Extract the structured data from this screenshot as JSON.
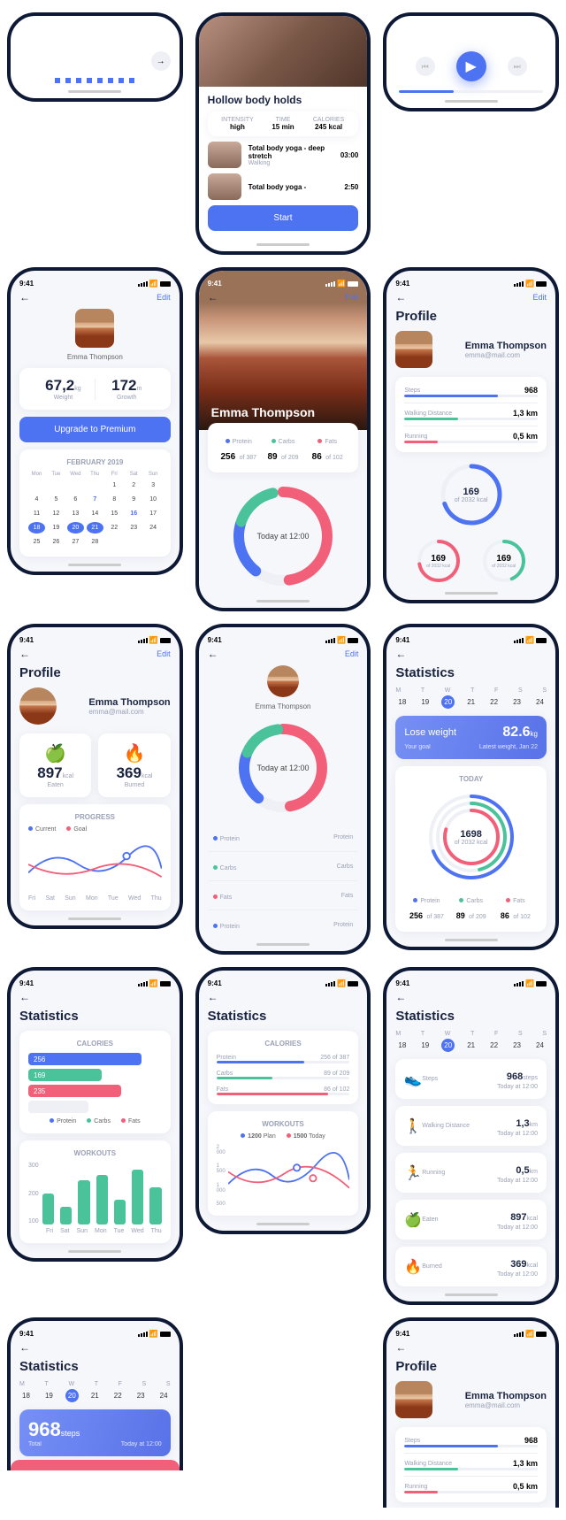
{
  "time": "9:41",
  "edit": "Edit",
  "user": {
    "name": "Emma Thompson",
    "email": "emma@mail.com"
  },
  "profileTitle": "Profile",
  "statsTitle": "Statistics",
  "upgrade": "Upgrade to Premium",
  "month": "FEBRUARY 2019",
  "weekdays": [
    "Mon",
    "Tue",
    "Wed",
    "Thu",
    "Fri",
    "Sat",
    "Sun"
  ],
  "weekLetters": [
    "M",
    "T",
    "W",
    "T",
    "F",
    "S",
    "S"
  ],
  "weekDates": [
    "18",
    "19",
    "20",
    "21",
    "22",
    "23",
    "24"
  ],
  "stats": {
    "weight": {
      "val": "67,2",
      "unit": "kg",
      "label": "Weight"
    },
    "growth": {
      "val": "172",
      "unit": "m",
      "label": "Growth"
    },
    "eaten": {
      "val": "897",
      "unit": "kcal",
      "label": "Eaten"
    },
    "burned": {
      "val": "369",
      "unit": "kcal",
      "label": "Burned"
    }
  },
  "progress": {
    "title": "PROGRESS",
    "current": "Current",
    "goal": "Goal"
  },
  "workout": {
    "title": "Hollow body holds",
    "intensity": {
      "label": "INTENSITY",
      "val": "high"
    },
    "time": {
      "label": "TIME",
      "val": "15 min"
    },
    "calories": {
      "label": "CALORIES",
      "val": "245 kcal"
    },
    "item1": {
      "title": "Total body yoga - deep stretch",
      "cat": "Walking",
      "dur": "03:00"
    },
    "item2": {
      "title": "Total body yoga -",
      "dur": "2:50"
    },
    "start": "Start"
  },
  "macros": {
    "protein": {
      "label": "Protein",
      "val": "256",
      "of": "of 387"
    },
    "carbs": {
      "label": "Carbs",
      "val": "89",
      "of": "of 209"
    },
    "fats": {
      "label": "Fats",
      "val": "86",
      "of": "of 102"
    }
  },
  "today12": "Today at 12:00",
  "metrics": {
    "steps": {
      "label": "Steps",
      "val": "968",
      "unit": "steps"
    },
    "walk": {
      "label": "Walking Distance",
      "val": "1,3",
      "unit": "km"
    },
    "run": {
      "label": "Running",
      "val": "0,5",
      "unit": "km"
    }
  },
  "ring": {
    "val": "169",
    "of": "of 2032 kcal"
  },
  "lose": {
    "title": "Lose weight",
    "goal": "Your goal",
    "val": "82.6",
    "unit": "kg",
    "latest": "Latest weight, Jan 22"
  },
  "todayLabel": "TODAY",
  "todayRing": {
    "val": "1698",
    "of": "of 2032 kcal"
  },
  "caloriesTitle": "CALORIES",
  "workoutsTitle": "WORKOUTS",
  "bars": {
    "b1": "256",
    "b2": "169",
    "b3": "235"
  },
  "chartDays": [
    "Fri",
    "Sat",
    "Sun",
    "Mon",
    "Tue",
    "Wed",
    "Thu"
  ],
  "totalCard": {
    "val": "968",
    "unit": "steps",
    "label": "Total",
    "time": "Today at 12:00"
  },
  "plan": {
    "plan": "1200",
    "planLabel": "Plan",
    "today": "1500",
    "todayLabel": "Today"
  },
  "yaxis": [
    "300",
    "200",
    "100"
  ],
  "yaxis2": [
    "2 000",
    "1 500",
    "1 000",
    "500"
  ]
}
